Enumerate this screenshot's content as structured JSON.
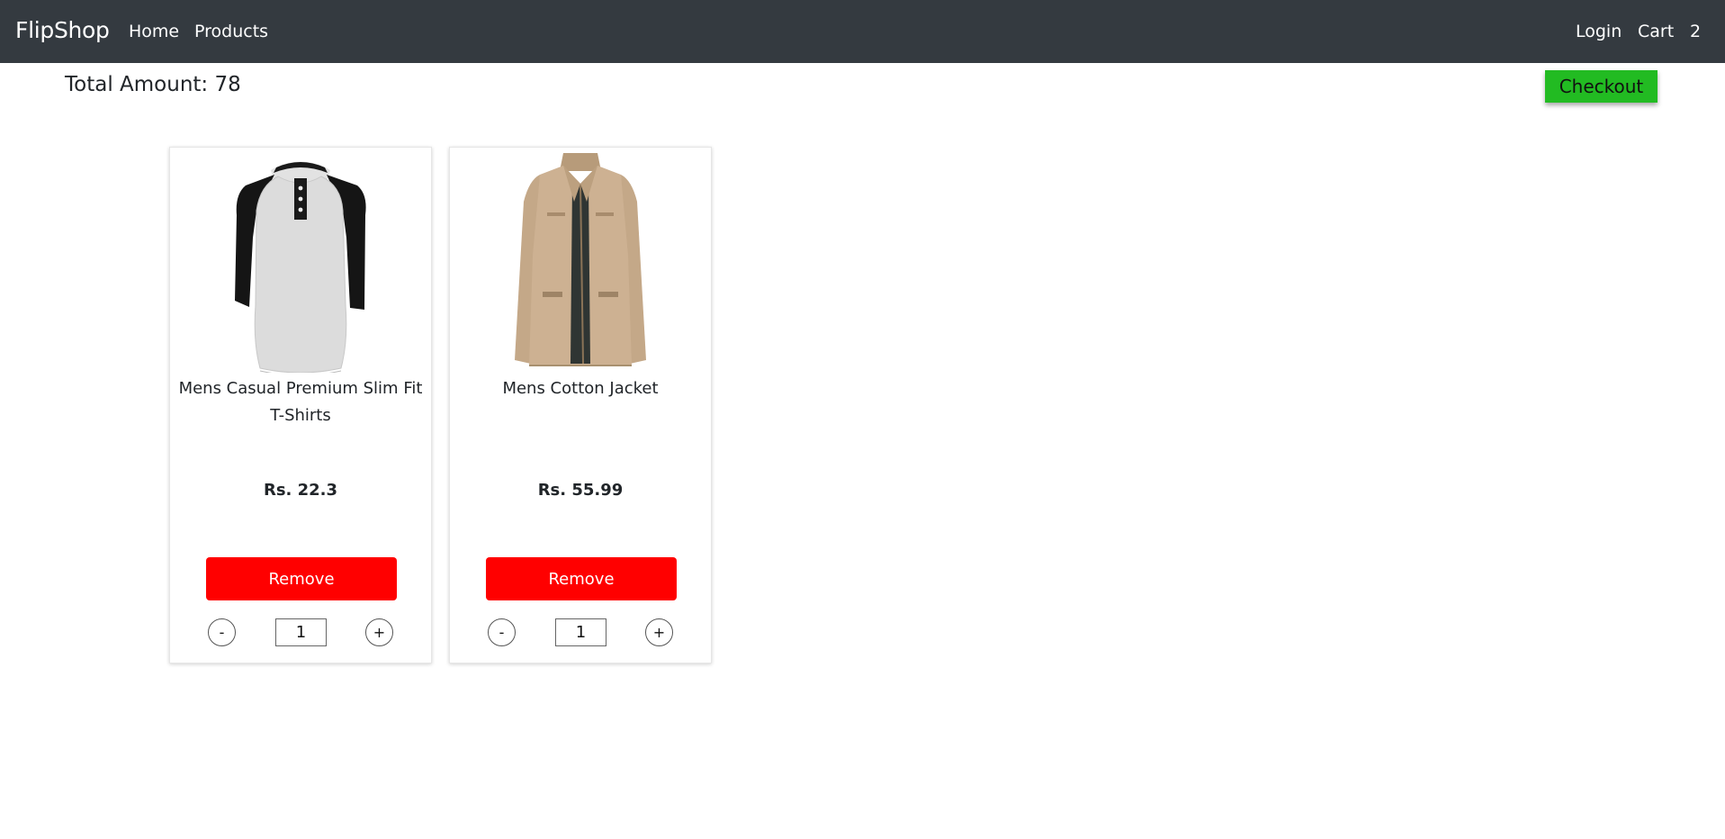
{
  "navbar": {
    "brand": "FlipShop",
    "links": [
      "Home",
      "Products"
    ],
    "login": "Login",
    "cart": "Cart",
    "cart_count": "2"
  },
  "summary": {
    "total_label": "Total Amount: 78",
    "checkout_label": "Checkout"
  },
  "colors": {
    "navbar_bg": "#343a40",
    "checkout_bg": "#22bb22",
    "remove_bg": "#ff0000"
  },
  "cart_items": [
    {
      "title": "Mens Casual Premium Slim Fit T-Shirts",
      "price": "Rs. 22.3",
      "remove_label": "Remove",
      "minus_label": "-",
      "plus_label": "+",
      "quantity": "1",
      "image": "raglan-henley-tshirt-photo"
    },
    {
      "title": "Mens Cotton Jacket",
      "price": "Rs. 55.99",
      "remove_label": "Remove",
      "minus_label": "-",
      "plus_label": "+",
      "quantity": "1",
      "image": "khaki-cotton-jacket-photo"
    }
  ]
}
